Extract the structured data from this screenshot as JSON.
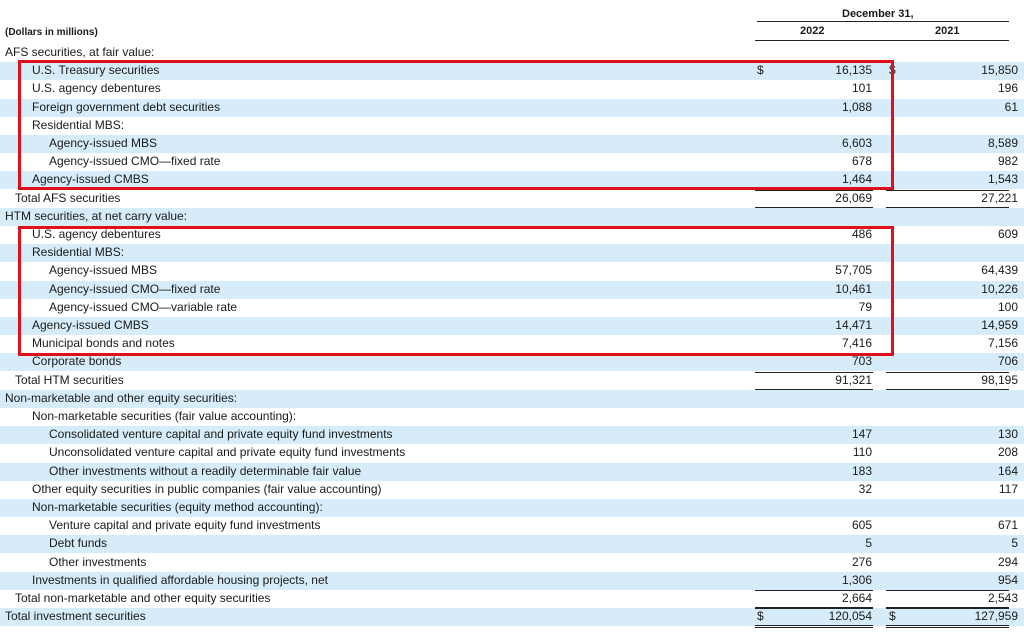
{
  "header": {
    "units_label": "(Dollars in millions)",
    "period_label": "December 31,",
    "col_2022": "2022",
    "col_2021": "2021"
  },
  "rows": [
    {
      "label": "AFS securities, at fair value:",
      "indent": 0,
      "v2022": "",
      "v2021": ""
    },
    {
      "label": "U.S. Treasury securities",
      "indent": 1,
      "v2022": "16,135",
      "v2021": "15,850",
      "dollar2022": "$",
      "dollar2021": "$"
    },
    {
      "label": "U.S. agency debentures",
      "indent": 1,
      "v2022": "101",
      "v2021": "196"
    },
    {
      "label": "Foreign government debt securities",
      "indent": 1,
      "v2022": "1,088",
      "v2021": "61"
    },
    {
      "label": "Residential MBS:",
      "indent": 1,
      "v2022": "",
      "v2021": ""
    },
    {
      "label": "Agency-issued MBS",
      "indent": 2,
      "v2022": "6,603",
      "v2021": "8,589"
    },
    {
      "label": "Agency-issued CMO—fixed rate",
      "indent": 2,
      "v2022": "678",
      "v2021": "982"
    },
    {
      "label": "Agency-issued CMBS",
      "indent": 1,
      "v2022": "1,464",
      "v2021": "1,543"
    },
    {
      "label": "Total AFS securities",
      "indent": 0.5,
      "v2022": "26,069",
      "v2021": "27,221",
      "total": true
    },
    {
      "label": "HTM securities, at net carry value:",
      "indent": 0,
      "v2022": "",
      "v2021": ""
    },
    {
      "label": "U.S. agency debentures",
      "indent": 1,
      "v2022": "486",
      "v2021": "609"
    },
    {
      "label": "Residential MBS:",
      "indent": 1,
      "v2022": "",
      "v2021": ""
    },
    {
      "label": "Agency-issued MBS",
      "indent": 2,
      "v2022": "57,705",
      "v2021": "64,439"
    },
    {
      "label": "Agency-issued CMO—fixed rate",
      "indent": 2,
      "v2022": "10,461",
      "v2021": "10,226"
    },
    {
      "label": "Agency-issued CMO—variable rate",
      "indent": 2,
      "v2022": "79",
      "v2021": "100"
    },
    {
      "label": "Agency-issued CMBS",
      "indent": 1,
      "v2022": "14,471",
      "v2021": "14,959"
    },
    {
      "label": "Municipal bonds and notes",
      "indent": 1,
      "v2022": "7,416",
      "v2021": "7,156"
    },
    {
      "label": "Corporate bonds",
      "indent": 1,
      "v2022": "703",
      "v2021": "706"
    },
    {
      "label": "Total HTM securities",
      "indent": 0.5,
      "v2022": "91,321",
      "v2021": "98,195",
      "total": true
    },
    {
      "label": "Non-marketable and other equity securities:",
      "indent": 0,
      "v2022": "",
      "v2021": ""
    },
    {
      "label": "Non-marketable securities (fair value accounting):",
      "indent": 1,
      "v2022": "",
      "v2021": ""
    },
    {
      "label": "Consolidated venture capital and private equity fund investments",
      "indent": 2,
      "v2022": "147",
      "v2021": "130"
    },
    {
      "label": "Unconsolidated venture capital and private equity fund investments",
      "indent": 2,
      "v2022": "110",
      "v2021": "208"
    },
    {
      "label": "Other investments without a readily determinable fair value",
      "indent": 2,
      "v2022": "183",
      "v2021": "164"
    },
    {
      "label": "Other equity securities in public companies (fair value accounting)",
      "indent": 1,
      "v2022": "32",
      "v2021": "117"
    },
    {
      "label": "Non-marketable securities (equity method accounting):",
      "indent": 1,
      "v2022": "",
      "v2021": ""
    },
    {
      "label": "Venture capital and private equity fund investments",
      "indent": 2,
      "v2022": "605",
      "v2021": "671"
    },
    {
      "label": "Debt funds",
      "indent": 2,
      "v2022": "5",
      "v2021": "5"
    },
    {
      "label": "Other investments",
      "indent": 2,
      "v2022": "276",
      "v2021": "294"
    },
    {
      "label": "Investments in qualified affordable housing projects, net",
      "indent": 1,
      "v2022": "1,306",
      "v2021": "954"
    },
    {
      "label": "Total non-marketable and other equity securities",
      "indent": 0.5,
      "v2022": "2,664",
      "v2021": "2,543",
      "total": true
    },
    {
      "label": "Total investment securities",
      "indent": 0,
      "v2022": "120,054",
      "v2021": "127,959",
      "dollar2022": "$",
      "dollar2021": "$",
      "grand": true
    }
  ],
  "colors": {
    "row_shade": "#d6ecfa",
    "highlight_box": "#e0101a"
  }
}
